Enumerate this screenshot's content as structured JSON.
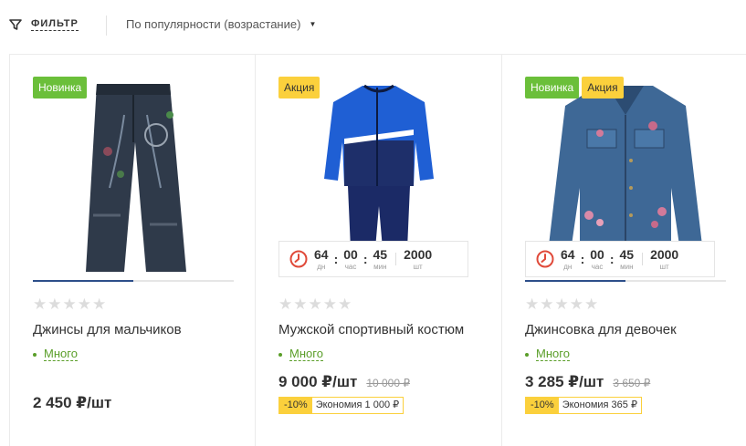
{
  "toolbar": {
    "filter_label": "ФИЛЬТР",
    "sort_label": "По популярности (возрастание)"
  },
  "products": [
    {
      "badges": [
        "Новинка"
      ],
      "rating": 0,
      "stars": "★★★★★",
      "title": "Джинсы для мальчиков",
      "stock": "Много",
      "price": "2 450 ₽/шт",
      "image": "jeans-image",
      "gallery_active": 0.5
    },
    {
      "badges": [
        "Акция"
      ],
      "timer": {
        "days": "64",
        "days_unit": "дн",
        "hours": "00",
        "hours_unit": "час",
        "minutes": "45",
        "minutes_unit": "мин",
        "qty": "2000",
        "qty_unit": "шт"
      },
      "rating": 0,
      "stars": "★★★★★",
      "title": "Мужской спортивный костюм",
      "stock": "Много",
      "price": "9 000 ₽/шт",
      "old_price": "10 000 ₽",
      "discount": "-10%",
      "savings": "Экономия 1 000 ₽",
      "image": "tracksuit-image"
    },
    {
      "badges": [
        "Новинка",
        "Акция"
      ],
      "timer": {
        "days": "64",
        "days_unit": "дн",
        "hours": "00",
        "hours_unit": "час",
        "minutes": "45",
        "minutes_unit": "мин",
        "qty": "2000",
        "qty_unit": "шт"
      },
      "rating": 0,
      "stars": "★★★★★",
      "title": "Джинсовка для девочек",
      "stock": "Много",
      "price": "3 285 ₽/шт",
      "old_price": "3 650 ₽",
      "discount": "-10%",
      "savings": "Экономия 365 ₽",
      "image": "denim-jacket-image",
      "gallery_active": 0.5
    }
  ],
  "colors": {
    "badge_new": "#6bbf3a",
    "badge_sale": "#fbd03c",
    "stock": "#5a9e29",
    "timer_icon": "#e04a3a"
  }
}
